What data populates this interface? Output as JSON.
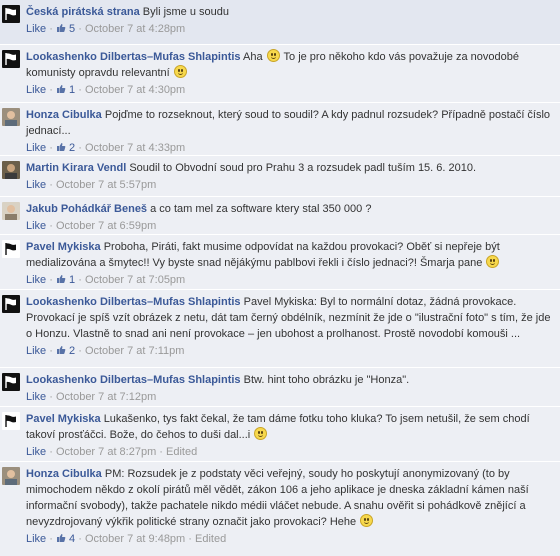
{
  "comments": [
    {
      "author": "Česká pirátská strana",
      "avatar": "pirate-flag",
      "text_parts": [
        "Byli jsme u soudu"
      ],
      "like_label": "Like",
      "likes": "5",
      "time": "October 7 at 4:28pm",
      "edited": ""
    },
    {
      "author": "Lookashenko Dilbertas–Mufas Shlapintis",
      "avatar": "pirate-flag",
      "text_parts": [
        "Aha ",
        " To je pro někoho kdo vás považuje za novodobé komunisty opravdu relevantní "
      ],
      "like_label": "Like",
      "likes": "1",
      "time": "October 7 at 4:30pm",
      "edited": ""
    },
    {
      "author": "Honza Cibulka",
      "avatar": "person-photo",
      "text_parts": [
        "Pojďme to rozseknout, který soud to soudil? A kdy padnul rozsudek? Případně postačí číslo jednací..."
      ],
      "like_label": "Like",
      "likes": "2",
      "time": "October 7 at 4:33pm",
      "edited": ""
    },
    {
      "author": "Martin Kirara Vendl",
      "avatar": "person-photo-dark",
      "text_parts": [
        "Soudil to Obvodní soud pro Prahu 3 a rozsudek padl tuším 15. 6. 2010."
      ],
      "like_label": "Like",
      "likes": "",
      "time": "October 7 at 5:57pm",
      "edited": ""
    },
    {
      "author": "Jakub Pohádkář Beneš",
      "avatar": "person-photo-light",
      "text_parts": [
        "a co tam mel za software ktery stal 350 000 ?"
      ],
      "like_label": "Like",
      "likes": "",
      "time": "October 7 at 6:59pm",
      "edited": ""
    },
    {
      "author": "Pavel Mykiska",
      "avatar": "pirate-flag-white",
      "text_parts": [
        "Proboha, Piráti, fakt musime odpovídat na každou provokaci? Oběť si nepřeje být medializována a šmytec!! Vy byste snad nějákýmu pablbovi řekli i číslo jednaci?! Šmarja pane "
      ],
      "like_label": "Like",
      "likes": "1",
      "time": "October 7 at 7:05pm",
      "edited": ""
    },
    {
      "author": "Lookashenko Dilbertas–Mufas Shlapintis",
      "avatar": "pirate-flag",
      "text_parts": [
        "Pavel Mykiska: Byl to normální dotaz, žádná provokace. Provokací je spíš vzít obrázek z netu, dát tam černý obdélník, nezmínit že jde o \"ilustrační foto\" s tím, že jde o Honzu. Vlastně to snad ani není provokace – jen ubohost a prolhanost. Prostě novodobí komouši ..."
      ],
      "like_label": "Like",
      "likes": "2",
      "time": "October 7 at 7:11pm",
      "edited": ""
    },
    {
      "author": "Lookashenko Dilbertas–Mufas Shlapintis",
      "avatar": "pirate-flag",
      "text_parts": [
        "Btw. hint toho obrázku je \"Honza\"."
      ],
      "like_label": "Like",
      "likes": "",
      "time": "October 7 at 7:12pm",
      "edited": ""
    },
    {
      "author": "Pavel Mykiska",
      "avatar": "pirate-flag-white",
      "text_parts": [
        "Lukašenko, tys fakt čekal, že tam dáme fotku toho kluka? To jsem netušil, že sem chodí takoví prosťáčci. Bože, do čehos to duši dal...i "
      ],
      "like_label": "Like",
      "likes": "",
      "time": "October 7 at 8:27pm",
      "edited": "Edited"
    },
    {
      "author": "Honza Cibulka",
      "avatar": "person-photo",
      "text_parts": [
        "PM: Rozsudek je z podstaty věci veřejný, soudy ho poskytují anonymizovaný (to by mimochodem někdo z okolí pirátů měl vědět, zákon 106 a jeho aplikace je dneska základní kámen naší informační svobody), takže pachatele nikdo médii vláčet nebude. A snahu ověřit si pohádkově znějící a nevyzdrojovaný výkřik politické strany označit jako provokaci? Hehe "
      ],
      "like_label": "Like",
      "likes": "4",
      "time": "October 7 at 9:48pm",
      "edited": "Edited"
    }
  ]
}
